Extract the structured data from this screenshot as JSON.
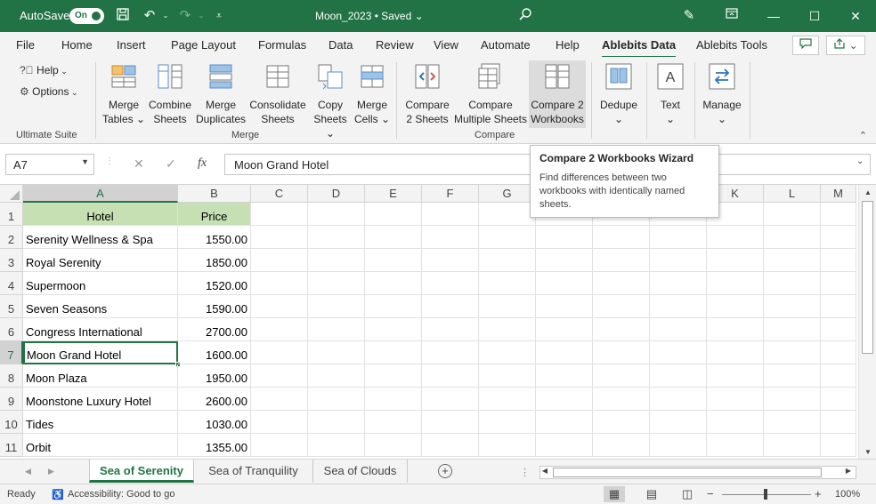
{
  "titlebar": {
    "autosave_label": "AutoSave",
    "autosave_state": "On",
    "doc_title": "Moon_2023 • Saved ⌄"
  },
  "tabs": [
    "File",
    "Home",
    "Insert",
    "Page Layout",
    "Formulas",
    "Data",
    "Review",
    "View",
    "Automate",
    "Help",
    "Ablebits Data",
    "Ablebits Tools"
  ],
  "active_tab": "Ablebits Data",
  "ribbon": {
    "ultimate": {
      "help": "Help",
      "options": "Options",
      "group": "Ultimate Suite"
    },
    "merge": {
      "group": "Merge",
      "buttons": [
        {
          "line1": "Merge",
          "line2": "Tables ⌄"
        },
        {
          "line1": "Combine",
          "line2": "Sheets"
        },
        {
          "line1": "Merge",
          "line2": "Duplicates"
        },
        {
          "line1": "Consolidate",
          "line2": "Sheets"
        },
        {
          "line1": "Copy",
          "line2": "Sheets ⌄"
        },
        {
          "line1": "Merge",
          "line2": "Cells ⌄"
        }
      ]
    },
    "compare": {
      "group": "Compare",
      "buttons": [
        {
          "line1": "Compare",
          "line2": "2 Sheets"
        },
        {
          "line1": "Compare",
          "line2": "Multiple Sheets"
        },
        {
          "line1": "Compare 2",
          "line2": "Workbooks"
        }
      ]
    },
    "dedupe": {
      "line1": "Dedupe",
      "line2": "⌄"
    },
    "text": {
      "line1": "Text",
      "line2": "⌄"
    },
    "manage": {
      "line1": "Manage",
      "line2": "⌄"
    }
  },
  "formula_bar": {
    "name_box": "A7",
    "fx": "fx",
    "content": "Moon Grand Hotel"
  },
  "tooltip": {
    "title": "Compare 2 Workbooks Wizard",
    "body": "Find differences between two workbooks with identically named sheets."
  },
  "columns": [
    "A",
    "B",
    "C",
    "D",
    "E",
    "F",
    "G",
    "H",
    "I",
    "J",
    "K",
    "L",
    "M"
  ],
  "rows": [
    "1",
    "2",
    "3",
    "4",
    "5",
    "6",
    "7",
    "8",
    "9",
    "10",
    "11"
  ],
  "table": {
    "header": [
      "Hotel",
      "Price"
    ],
    "data": [
      [
        "Serenity Wellness & Spa",
        "1550.00"
      ],
      [
        "Royal Serenity",
        "1850.00"
      ],
      [
        "Supermoon",
        "1520.00"
      ],
      [
        "Seven Seasons",
        "1590.00"
      ],
      [
        "Congress International",
        "2700.00"
      ],
      [
        "Moon Grand Hotel",
        "1600.00"
      ],
      [
        "Moon Plaza",
        "1950.00"
      ],
      [
        "Moonstone Luxury Hotel",
        "2600.00"
      ],
      [
        "Tides",
        "1030.00"
      ],
      [
        "Orbit",
        "1355.00"
      ]
    ]
  },
  "sheets": [
    "Sea of Serenity",
    "Sea of Tranquility",
    "Sea of Clouds"
  ],
  "active_sheet": "Sea of Serenity",
  "status": {
    "ready": "Ready",
    "accessibility": "Accessibility: Good to go",
    "zoom": "100%"
  },
  "colors": {
    "excel_green": "#217346",
    "header_fill": "#c6e0b4"
  }
}
